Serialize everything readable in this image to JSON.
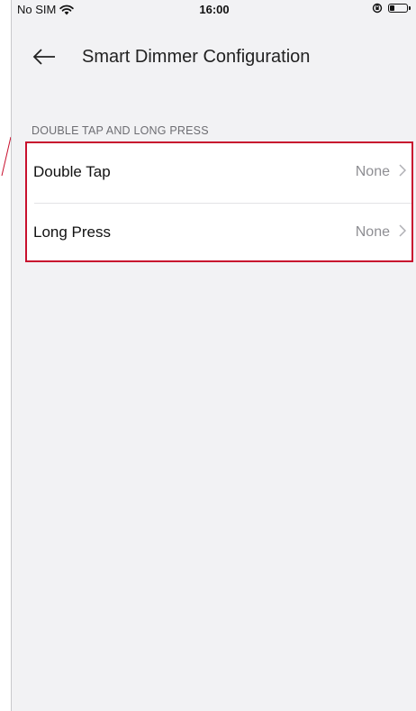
{
  "status_bar": {
    "carrier": "No SIM",
    "time": "16:00"
  },
  "header": {
    "title": "Smart Dimmer Configuration"
  },
  "section": {
    "label": "DOUBLE TAP AND LONG PRESS"
  },
  "rows": [
    {
      "label": "Double Tap",
      "value": "None"
    },
    {
      "label": "Long Press",
      "value": "None"
    }
  ],
  "colors": {
    "highlight": "#c8102e",
    "background": "#f2f2f4"
  }
}
